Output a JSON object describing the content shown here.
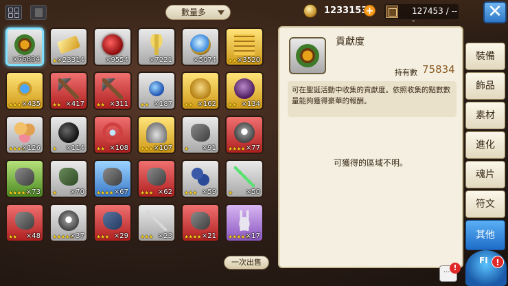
{
  "header": {
    "sort_label": "數量多",
    "zeny": "1233153",
    "zeny_add": "+",
    "capacity": "127453 / ---",
    "close": "✕"
  },
  "items": [
    {
      "icon": "star-wreath-icon",
      "bg": "g",
      "stars": "",
      "count": "×75834",
      "selected": true
    },
    {
      "icon": "gold-ingot-icon",
      "bg": "g",
      "stars": "★★",
      "count": "×23314"
    },
    {
      "icon": "red-orb-icon",
      "bg": "g",
      "stars": "",
      "count": "×9554"
    },
    {
      "icon": "wheat-icon",
      "bg": "g",
      "stars": "",
      "count": "×7221"
    },
    {
      "icon": "blue-orb-icon",
      "bg": "g",
      "stars": "",
      "count": "×5074"
    },
    {
      "icon": "gold-bars-icon",
      "bg": "y",
      "stars": "★★★",
      "count": "×3520"
    },
    {
      "icon": "blue-amulet-icon",
      "bg": "y",
      "stars": "★★★",
      "count": "×435"
    },
    {
      "icon": "hammer-icon",
      "bg": "r",
      "stars": "★★",
      "count": "×417"
    },
    {
      "icon": "hammer-icon",
      "bg": "r",
      "stars": "★★",
      "count": "×311"
    },
    {
      "icon": "blue-gem-icon",
      "bg": "g",
      "stars": "★★",
      "count": "×187"
    },
    {
      "icon": "golden-mask-icon",
      "bg": "y",
      "stars": "★★",
      "count": "×162"
    },
    {
      "icon": "plum-icon",
      "bg": "y",
      "stars": "★★",
      "count": "×134"
    },
    {
      "icon": "dumplings-icon",
      "bg": "g",
      "stars": "★★★★",
      "count": "×126"
    },
    {
      "icon": "bomb-icon",
      "bg": "g",
      "stars": "★",
      "count": "×114"
    },
    {
      "icon": "ring-icon",
      "bg": "r",
      "stars": "★★",
      "count": "×108"
    },
    {
      "icon": "helmet-icon",
      "bg": "y",
      "stars": "★★★★★",
      "count": "×107"
    },
    {
      "icon": "gray-stone-icon",
      "bg": "g",
      "stars": "★",
      "count": "×91"
    },
    {
      "icon": "sprite-stone-icon",
      "bg": "r",
      "stars": "★★★★",
      "count": "×77"
    },
    {
      "icon": "gray-stone-icon",
      "bg": "gr",
      "stars": "★★★★★",
      "count": "×73"
    },
    {
      "icon": "green-stone-icon",
      "bg": "g",
      "stars": "★",
      "count": "×70"
    },
    {
      "icon": "gray-stone-icon",
      "bg": "b",
      "stars": "★★★★",
      "count": "×67"
    },
    {
      "icon": "gray-stone-icon",
      "bg": "r",
      "stars": "★★★",
      "count": "×62"
    },
    {
      "icon": "blue-beans-icon",
      "bg": "g",
      "stars": "★★★",
      "count": "×59"
    },
    {
      "icon": "green-spear-icon",
      "bg": "g",
      "stars": "★",
      "count": "×50"
    },
    {
      "icon": "gray-stone-icon",
      "bg": "r",
      "stars": "★★",
      "count": "×48"
    },
    {
      "icon": "sprite-stone-icon",
      "bg": "g",
      "stars": "★★★★★",
      "count": "×37"
    },
    {
      "icon": "blue-stone-icon",
      "bg": "r",
      "stars": "★★★",
      "count": "×29"
    },
    {
      "icon": "staff-icon",
      "bg": "g",
      "stars": "★★★",
      "count": "×23"
    },
    {
      "icon": "gray-stone-icon",
      "bg": "r",
      "stars": "★★★★",
      "count": "×21"
    },
    {
      "icon": "rabbit-stone-icon",
      "bg": "p",
      "stars": "★★★★★",
      "count": "×17"
    }
  ],
  "sell_all": "一次出售",
  "detail": {
    "name": "貢獻度",
    "own_label": "持有數",
    "own_value": "75834",
    "description": "可在聖誕活動中收集的貢獻度。依照收集的點數數量能夠獲得豪華的報酬。",
    "region": "可獲得的區域不明。"
  },
  "tabs": [
    "裝備",
    "飾品",
    "素材",
    "進化",
    "魂片",
    "符文",
    "其他"
  ],
  "active_tab": "其他",
  "alerts": {
    "chat": "!",
    "mascot": "!",
    "mascot_label": "FI"
  }
}
